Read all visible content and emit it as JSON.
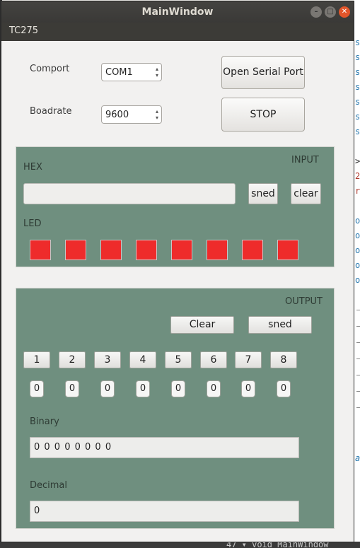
{
  "window": {
    "title": "MainWindow"
  },
  "menu": {
    "items": [
      "TC275"
    ]
  },
  "serial": {
    "comport_label": "Comport",
    "comport_value": "COM1",
    "baudrate_label": "Boadrate",
    "baudrate_value": "9600",
    "open_button": "Open Serial Port",
    "stop_button": "STOP"
  },
  "input": {
    "title": "INPUT",
    "hex_label": "HEX",
    "hex_value": "",
    "send_button": "sned",
    "clear_button": "clear",
    "led_label": "LED",
    "led_color": "#ee2b2b",
    "led_count": 8
  },
  "output": {
    "title": "OUTPUT",
    "clear_button": "Clear",
    "send_button": "sned",
    "bit_buttons": [
      "1",
      "2",
      "3",
      "4",
      "5",
      "6",
      "7",
      "8"
    ],
    "bit_values": [
      "0",
      "0",
      "0",
      "0",
      "0",
      "0",
      "0",
      "0"
    ],
    "binary_label": "Binary",
    "binary_value": "0 0 0 0 0 0 0 0",
    "decimal_label": "Decimal",
    "decimal_value": "0"
  },
  "background_editor": {
    "right_chars": [
      "s",
      "s",
      "s",
      "s",
      "s",
      "s",
      "s",
      ">",
      "2",
      "r",
      "o",
      "o",
      "o",
      "o",
      "o",
      "a"
    ],
    "bottom_text": "47 ▾ void MainWindow"
  },
  "colors": {
    "panel_bg": "#6f8f7f",
    "titlebar_bg": "#3c3b37",
    "close_btn": "#e2552a"
  }
}
